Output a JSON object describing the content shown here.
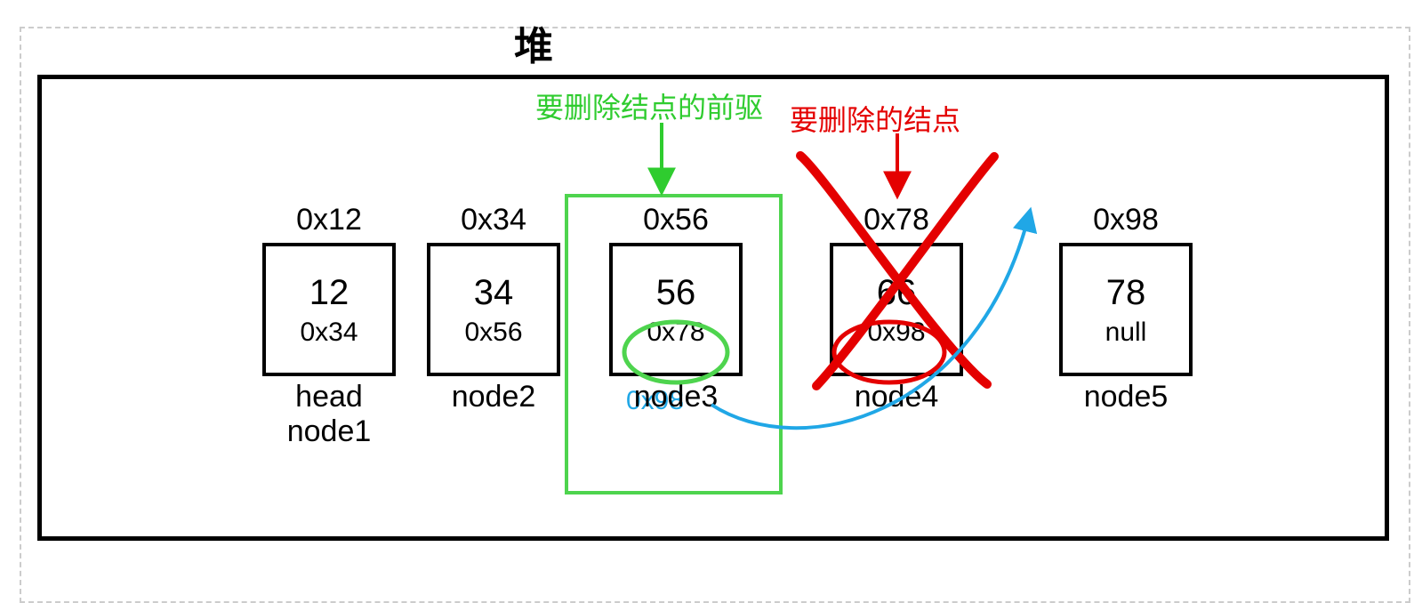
{
  "title": "堆",
  "annotations": {
    "predecessor_label": "要删除结点的前驱",
    "delete_label": "要删除的结点",
    "new_next": "0x98"
  },
  "nodes": [
    {
      "addr": "0x12",
      "val": "12",
      "next": "0x34",
      "labels": [
        "head",
        "node1"
      ]
    },
    {
      "addr": "0x34",
      "val": "34",
      "next": "0x56",
      "labels": [
        "node2"
      ]
    },
    {
      "addr": "0x56",
      "val": "56",
      "next": "0x78",
      "labels": [
        "node3"
      ]
    },
    {
      "addr": "0x78",
      "val": "66",
      "next": "0x98",
      "labels": [
        "node4"
      ]
    },
    {
      "addr": "0x98",
      "val": "78",
      "next": "null",
      "labels": [
        "node5"
      ]
    }
  ],
  "colors": {
    "green": "#4ed44e",
    "red": "#e40000",
    "cyan": "#20a7e6",
    "black": "#000000"
  }
}
